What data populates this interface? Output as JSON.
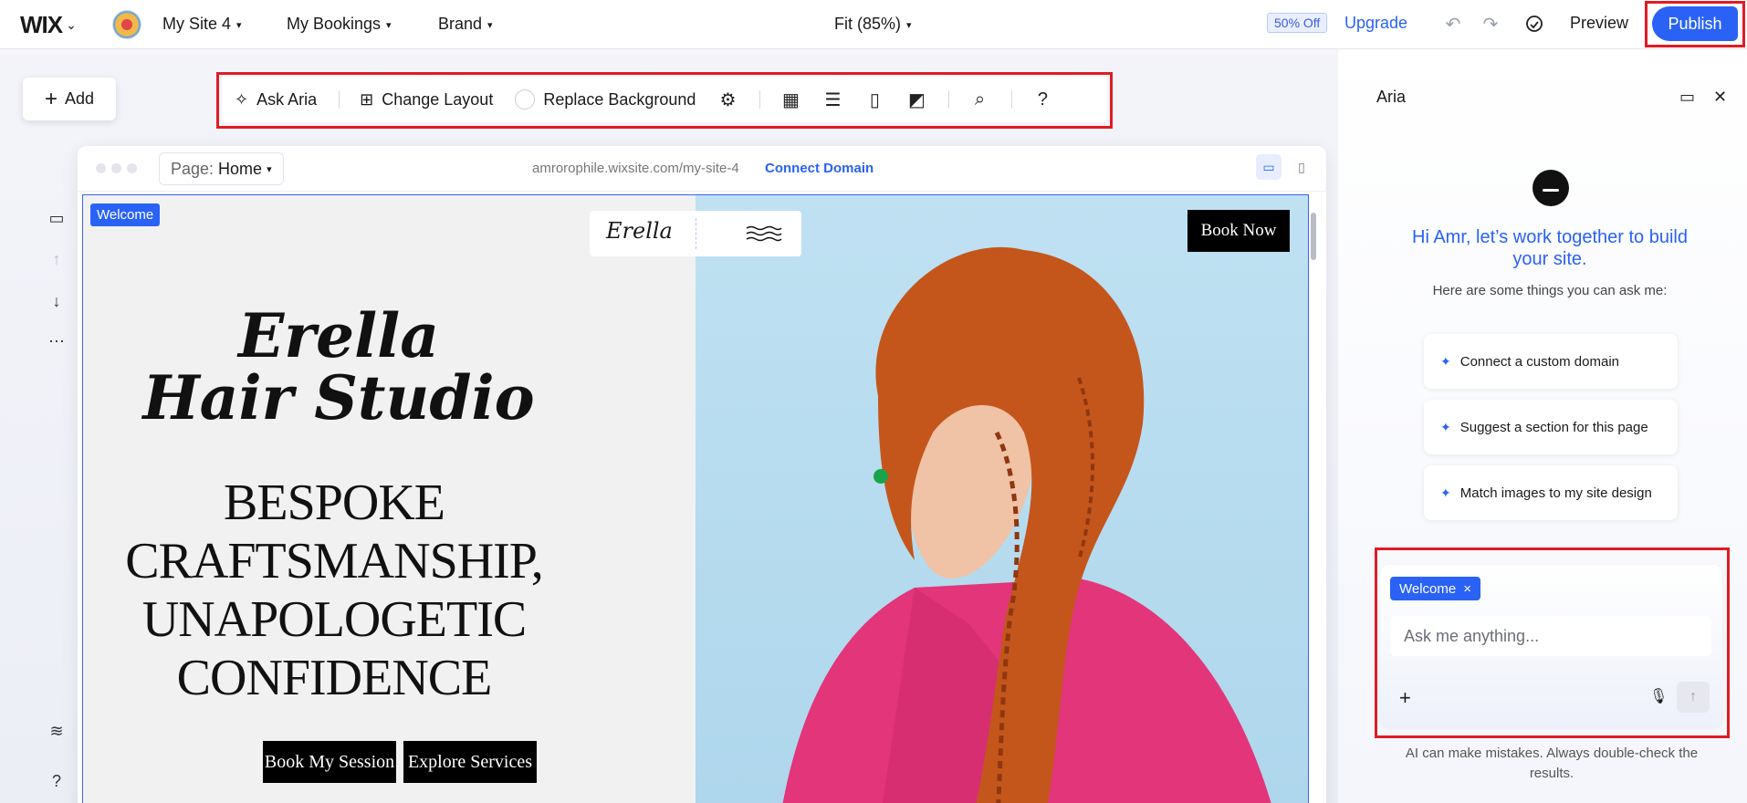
{
  "topbar": {
    "logo": "WIX",
    "site_name": "My Site 4",
    "bookings": "My Bookings",
    "brand": "Brand",
    "zoom": "Fit (85%)",
    "discount_badge": "50% Off",
    "upgrade": "Upgrade",
    "preview": "Preview",
    "publish": "Publish"
  },
  "left": {
    "add_label": "Add"
  },
  "toolbar": {
    "ask_aria": "Ask Aria",
    "change_layout": "Change Layout",
    "replace_background": "Replace Background",
    "help": "?"
  },
  "frame": {
    "page_label": "Page:",
    "page_value": "Home",
    "url": "amrorophile.wixsite.com/my-site-4",
    "connect_domain": "Connect Domain"
  },
  "site": {
    "section_tag": "Welcome",
    "nav_logo": "Erella",
    "book_now": "Book Now",
    "title_line1": "Erella",
    "title_line2": "Hair Studio",
    "subtitle": "BESPOKE CRAFTSMANSHIP, UNAPOLOGETIC CONFIDENCE",
    "cta_primary": "Book My Session",
    "cta_secondary": "Explore Services"
  },
  "aria": {
    "title": "Aria",
    "greeting": "Hi Amr, let’s work together to build your site.",
    "hint": "Here are some things you can ask me:",
    "suggestions": [
      "Connect a custom domain",
      "Suggest a section for this page",
      "Match images to my site design"
    ],
    "chip": "Welcome",
    "input_placeholder": "Ask me anything...",
    "disclaimer": "AI can make mistakes. Always double-check the results."
  },
  "rail": {
    "help": "?"
  },
  "colors": {
    "accent": "#2a62f5",
    "highlight_box": "#e01b24",
    "hero_shirt": "#e2357a",
    "hair": "#c4561c"
  },
  "icons": [
    "chevron-down-icon",
    "undo-icon",
    "redo-icon",
    "cloud-icon",
    "sparkle-icon",
    "layout-icon",
    "gear-icon",
    "grid-icon",
    "menu-icon",
    "columns-icon",
    "image-icon",
    "search-icon",
    "layers-icon",
    "desktop-icon",
    "mobile-icon",
    "comment-icon",
    "close-icon",
    "mic-icon",
    "send-icon"
  ]
}
